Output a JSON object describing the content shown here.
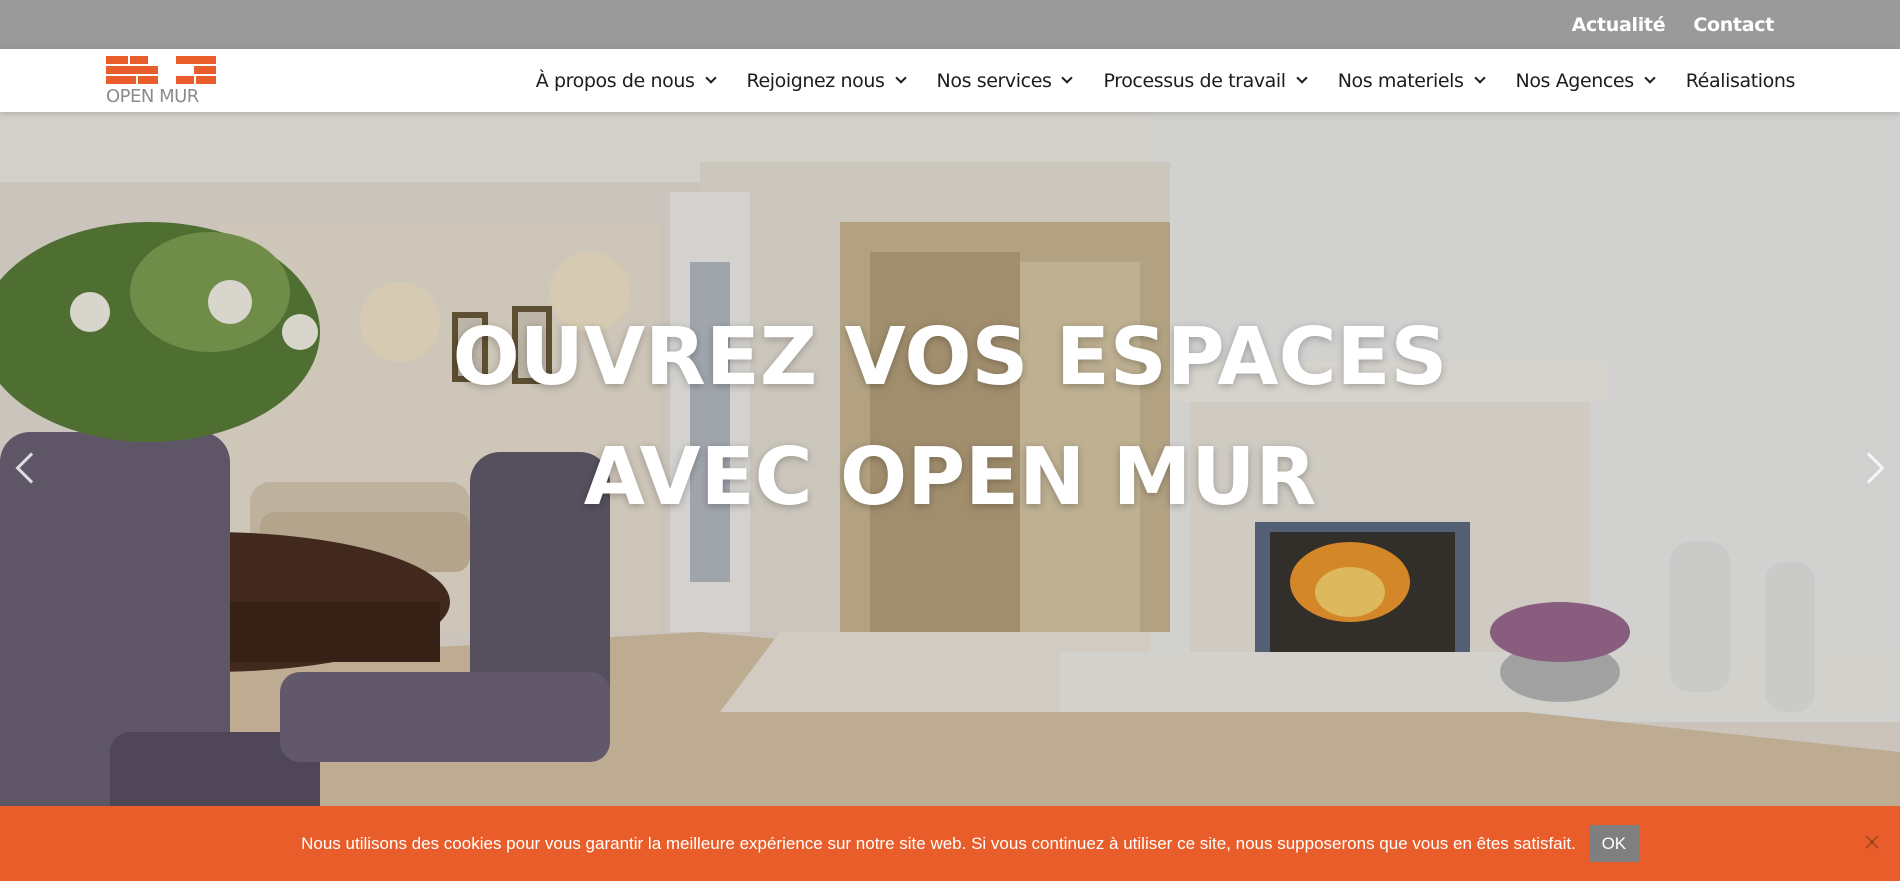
{
  "topbar": {
    "links": [
      "Actualité",
      "Contact"
    ]
  },
  "logo": {
    "text": "OPEN MUR",
    "brick_color": "#e85d2a",
    "text_color": "#8c8c8c"
  },
  "nav": {
    "items": [
      {
        "label": "À propos de nous",
        "dropdown": true
      },
      {
        "label": "Rejoignez nous",
        "dropdown": true
      },
      {
        "label": "Nos services",
        "dropdown": true
      },
      {
        "label": "Processus de travail",
        "dropdown": true
      },
      {
        "label": "Nos materiels",
        "dropdown": true
      },
      {
        "label": "Nos Agences",
        "dropdown": true
      },
      {
        "label": "Réalisations",
        "dropdown": false
      }
    ]
  },
  "hero": {
    "title": "OUVREZ VOS ESPACES AVEC OPEN MUR",
    "prev_icon": "chevron-left-icon",
    "next_icon": "chevron-right-icon"
  },
  "cookie": {
    "text": "Nous utilisons des cookies pour vous garantir la meilleure expérience sur notre site web. Si vous continuez à utiliser ce site, nous supposerons que vous en êtes satisfait.",
    "ok_label": "OK",
    "close_icon": "close-icon",
    "background": "#e85d2a"
  },
  "colors": {
    "topbar": "#9a9a9a",
    "accent": "#e85d2a"
  }
}
